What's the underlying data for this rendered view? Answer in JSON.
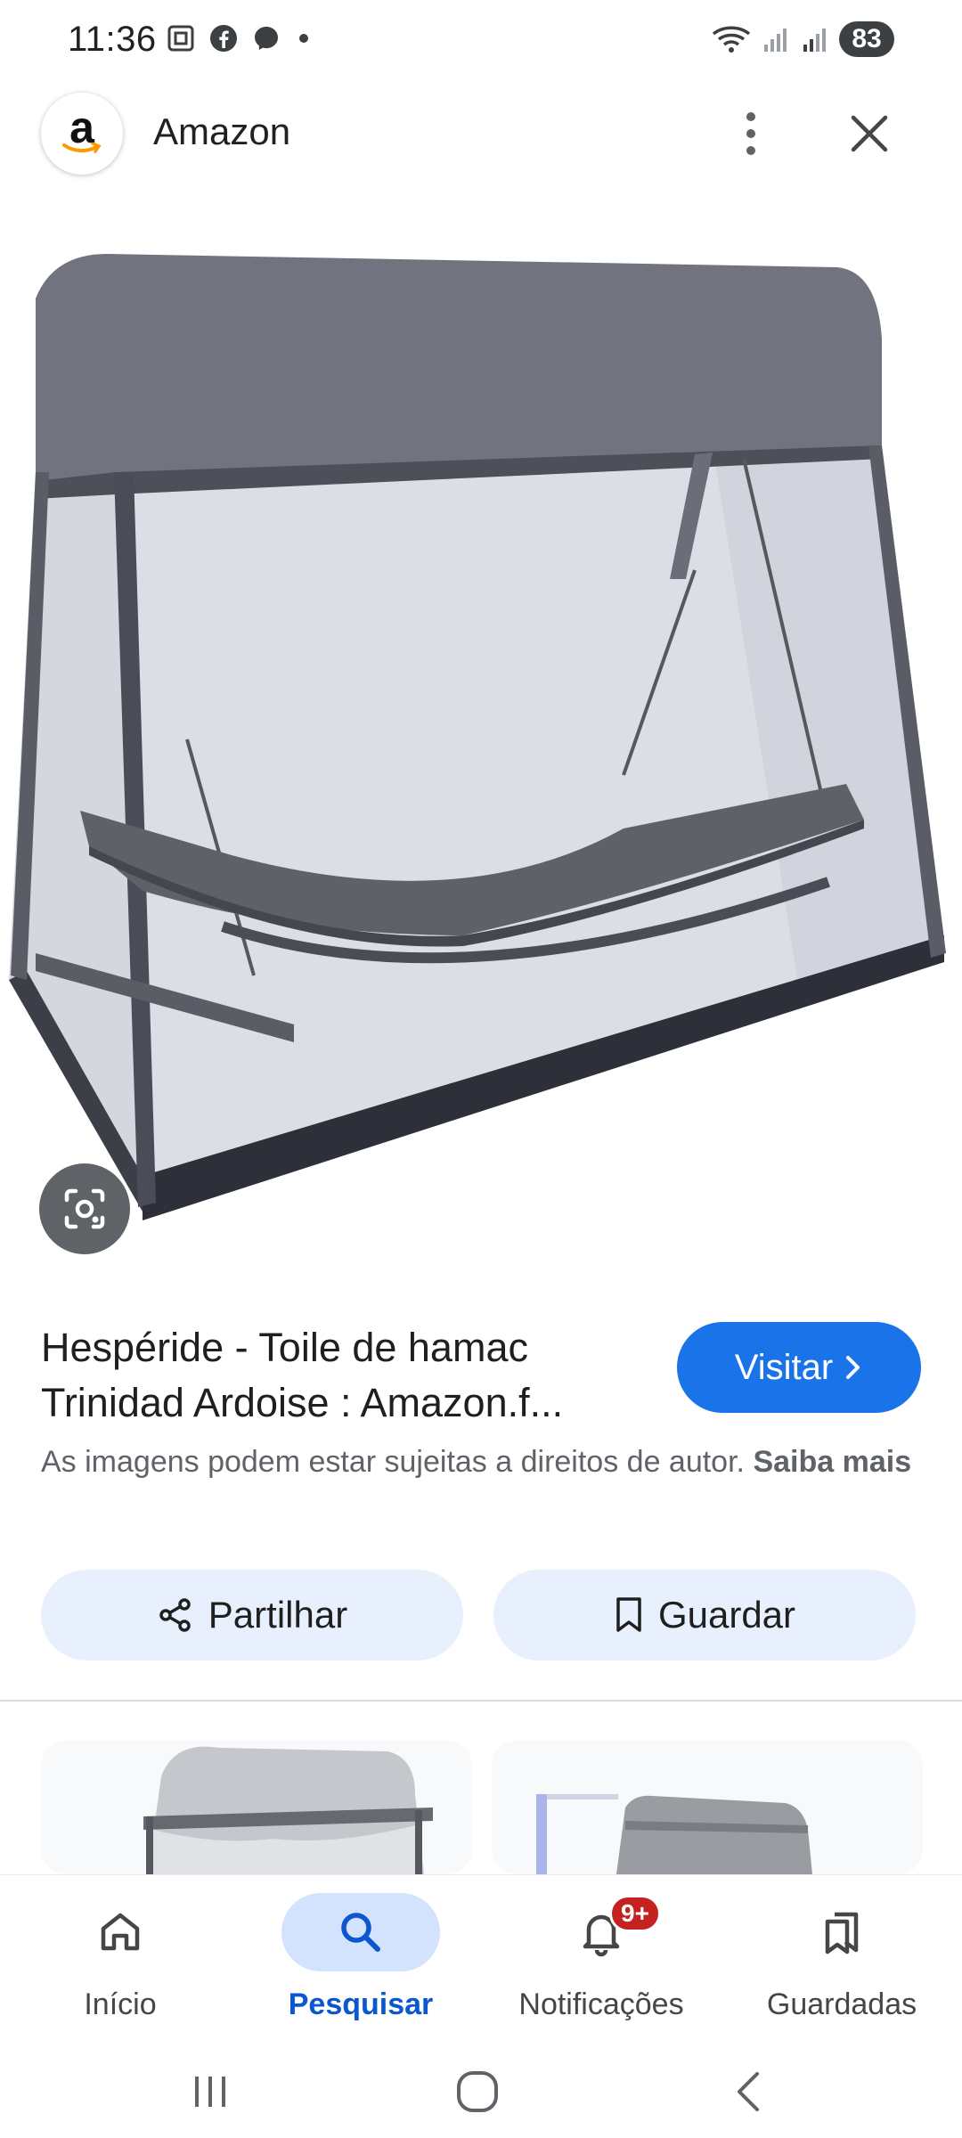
{
  "status_bar": {
    "time": "11:36",
    "battery": "83",
    "left_icons": [
      "screenshot-icon",
      "facebook-icon",
      "messenger-icon",
      "dot-icon"
    ],
    "right_icons": [
      "wifi-icon",
      "signal-icon",
      "signal-icon"
    ]
  },
  "header": {
    "logo_letter": "a",
    "site_name": "Amazon"
  },
  "result": {
    "title": "Hespéride - Toile de hamac Trinidad Ardoise : Amazon.f...",
    "visit_label": "Visitar",
    "copyright_text": "As imagens podem estar sujeitas a direitos de autor.",
    "learn_more": "Saiba mais"
  },
  "actions": {
    "share_label": "Partilhar",
    "save_label": "Guardar"
  },
  "bottom_nav": {
    "items": [
      {
        "label": "Início",
        "icon": "home-icon"
      },
      {
        "label": "Pesquisar",
        "icon": "search-icon"
      },
      {
        "label": "Notificações",
        "icon": "bell-icon",
        "badge": "9+"
      },
      {
        "label": "Guardadas",
        "icon": "bookmarks-icon"
      }
    ],
    "active": "Pesquisar"
  },
  "colors": {
    "accent": "#1a73e8",
    "action_bg": "#e8f0fe",
    "nav_active_bg": "#d3e3fd",
    "badge": "#c5221f"
  }
}
